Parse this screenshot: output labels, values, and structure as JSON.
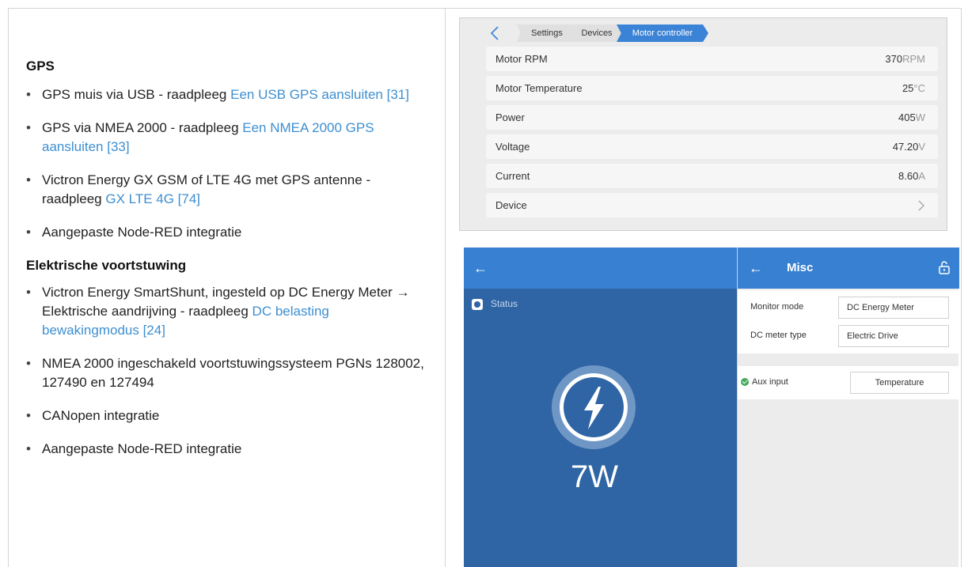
{
  "left": {
    "gps_heading": "GPS",
    "gps_items": [
      {
        "text": "GPS muis via USB - raadpleeg ",
        "link": "Een USB GPS aansluiten [31]"
      },
      {
        "text": "GPS via NMEA 2000 - raadpleeg ",
        "link": "Een NMEA 2000 GPS aansluiten [33]"
      },
      {
        "text": "Victron Energy GX GSM of LTE 4G met GPS antenne - raadpleeg ",
        "link": "GX LTE 4G [74]"
      },
      {
        "text": "Aangepaste Node-RED integratie",
        "link": ""
      }
    ],
    "elek_heading": "Elektrische voortstuwing",
    "elek_items": [
      {
        "text": "Victron Energy SmartShunt, ingesteld op DC Energy Meter → Elektrische aandrijving - raadpleeg ",
        "link": "DC belasting bewakingmodus [24]"
      },
      {
        "text": "NMEA 2000 ingeschakeld voortstuwingssysteem PGNs 128002, 127490 en 127494",
        "link": ""
      },
      {
        "text": "CANopen integratie",
        "link": ""
      },
      {
        "text": "Aangepaste Node-RED integratie",
        "link": ""
      }
    ],
    "bullet": "•"
  },
  "motor": {
    "breadcrumb": [
      "Settings",
      "Devices",
      "Motor controller"
    ],
    "rows": [
      {
        "label": "Motor RPM",
        "value": "370",
        "unit": "RPM"
      },
      {
        "label": "Motor Temperature",
        "value": "25",
        "unit": "°C"
      },
      {
        "label": "Power",
        "value": "405",
        "unit": "W"
      },
      {
        "label": "Voltage",
        "value": "47.20",
        "unit": "V"
      },
      {
        "label": "Current",
        "value": "8.60",
        "unit": "A"
      }
    ],
    "device_label": "Device"
  },
  "misc": {
    "back_arrow": "←",
    "status_label": "Status",
    "big_value": "7W",
    "title": "Misc",
    "monitor_mode_label": "Monitor mode",
    "monitor_mode_value": "DC Energy Meter",
    "dc_meter_type_label": "DC meter type",
    "dc_meter_type_value": "Electric Drive",
    "aux_input_label": "Aux input",
    "aux_input_value": "Temperature"
  },
  "colors": {
    "link": "#3d8fd1",
    "accent": "#3b83d6",
    "panel_blue": "#2f65a4"
  }
}
